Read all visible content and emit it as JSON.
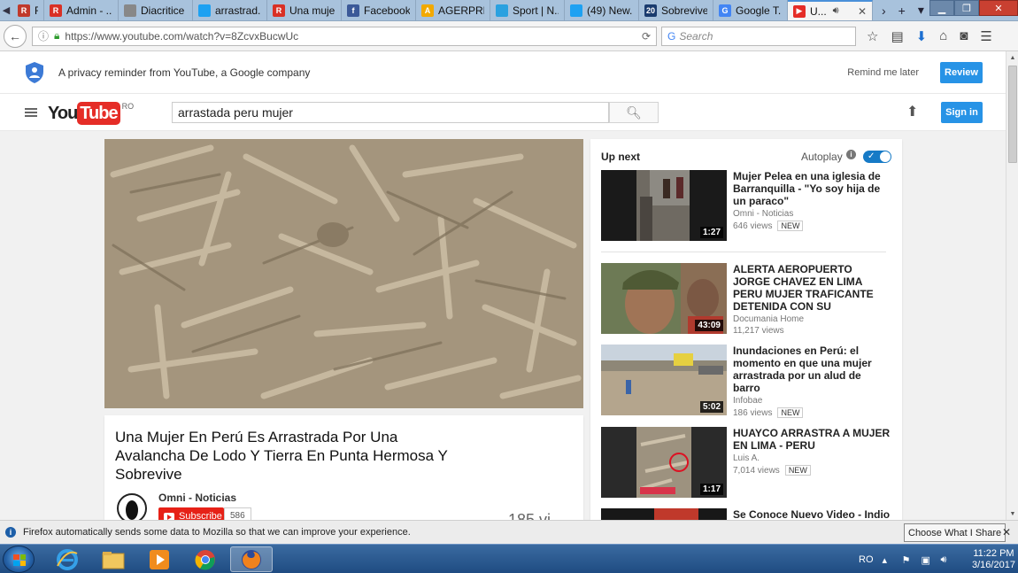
{
  "browser": {
    "tabs": [
      {
        "title": "R...",
        "color": "#c0392b",
        "glyph": "R"
      },
      {
        "title": "Admin - ...",
        "color": "#d93025",
        "glyph": "R"
      },
      {
        "title": "Diacritice (ăâî...",
        "color": "#888888",
        "glyph": ""
      },
      {
        "title": "arrastrad...",
        "color": "#1da1f2",
        "glyph": ""
      },
      {
        "title": "Una muje...",
        "color": "#d93025",
        "glyph": "R"
      },
      {
        "title": "Facebook",
        "color": "#3b5998",
        "glyph": "f"
      },
      {
        "title": "AGERPRE...",
        "color": "#f2a900",
        "glyph": "A"
      },
      {
        "title": "Sport | N...",
        "color": "#2aa1e0",
        "glyph": ""
      },
      {
        "title": "(49) New...",
        "color": "#1da1f2",
        "glyph": ""
      },
      {
        "title": "Sobrevive...",
        "color": "#1a3b6e",
        "glyph": "20"
      },
      {
        "title": "Google T...",
        "color": "#4285f4",
        "glyph": "G"
      },
      {
        "title": "U...",
        "color": "#e52d27",
        "glyph": "▶",
        "active": true
      }
    ],
    "url": "https://www.youtube.com/watch?v=8ZcvxBucwUc",
    "search_placeholder": "Search",
    "new_tab_symbol": "+"
  },
  "privacy": {
    "text": "A privacy reminder from YouTube, a Google company",
    "remind": "Remind me later",
    "review": "Review"
  },
  "youtube": {
    "logo_you": "You",
    "logo_tube": "Tube",
    "country": "RO",
    "search_value": "arrastada peru mujer",
    "signin": "Sign in"
  },
  "video": {
    "title": "Una Mujer En Perú Es Arrastrada Por Una Avalancha De Lodo Y Tierra En Punta Hermosa Y Sobrevive",
    "channel": "Omni - Noticias",
    "subscribe": "Subscribe",
    "subscribers": "586",
    "views_partial": "185 vi..."
  },
  "sidebar": {
    "up_next": "Up next",
    "autoplay": "Autoplay",
    "items": [
      {
        "title": "Mujer Pelea en una iglesia de Barranquilla - \"Yo soy hija de un paraco\"",
        "channel": "Omni - Noticias",
        "views": "646 views",
        "badge": "NEW",
        "duration": "1:27"
      },
      {
        "title": "ALERTA AEROPUERTO JORGE CHAVEZ EN LIMA PERU MUJER TRAFICANTE DETENIDA CON SU",
        "channel": "Documania Home",
        "views": "11,217 views",
        "badge": "",
        "duration": "43:09"
      },
      {
        "title": "Inundaciones en Perú: el momento en que una mujer arrastrada por un alud de barro",
        "channel": "Infobae",
        "views": "186 views",
        "badge": "NEW",
        "duration": "5:02"
      },
      {
        "title": "HUAYCO ARRASTRA A MUJER EN LIMA - PERU",
        "channel": "Luis A.",
        "views": "7,014 views",
        "badge": "NEW",
        "duration": "1:17"
      },
      {
        "title": "Se Conoce Nuevo Video - Indio",
        "channel": "",
        "views": "",
        "badge": "",
        "duration": ""
      }
    ]
  },
  "notification": {
    "message": "Firefox automatically sends some data to Mozilla so that we can improve your experience.",
    "button": "Choose What I Share"
  },
  "taskbar": {
    "lang": "RO",
    "time": "11:22 PM",
    "date": "3/16/2017"
  }
}
